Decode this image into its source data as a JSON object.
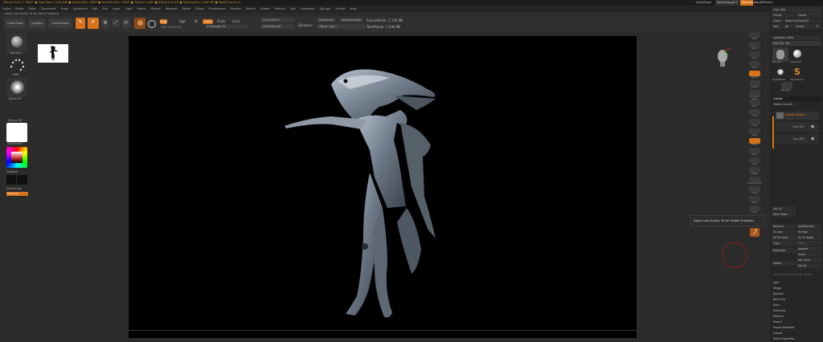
{
  "titlebar": {
    "text": "ZBrush 2021.7   Mat??   ● Free Mem 13.814GB ● Active Mem 4069 ● Scratch Disk 13252 ● Timer ▸ 0.001 ● ATime ▸ 0.013 ● PolyCount ▸ 3.581 MP ● MeshCount ▸ 2",
    "right_items": [
      "QuickSave",
      "See-through 0",
      "Menus",
      "DefaultZScript"
    ]
  },
  "menubar": {
    "items": [
      "Alpha",
      "Brush",
      "Color",
      "Document",
      "Draw",
      "Dynamics",
      "Edit",
      "File",
      "Layer",
      "Light",
      "Macro",
      "Marker",
      "Material",
      "Movie",
      "Picker",
      "Preferences",
      "Render",
      "Stencil",
      "Stroke",
      "Texture",
      "Tool",
      "Transform",
      "Zplugin",
      "Zscript",
      "Help"
    ]
  },
  "hint": "Apply Last Action To All Visible Subtools",
  "toolbar": {
    "home_page": "Home Page",
    "lightbox": "LightBox",
    "live_boolean": "Live Boolean",
    "edit": "Edit",
    "draw": "Draw",
    "move": "Move",
    "scale": "Scale",
    "rotate": "Rotate",
    "mrgb": "Mrgb",
    "rgb": "Rgb",
    "m": "M",
    "zadd": "Zadd",
    "zsub": "Zsub",
    "zcut": "Zcut",
    "rgb_intensity": "Rgb Intensity",
    "z_intensity": "Z Intensity 25",
    "focal_shift": "Focal Shift 0",
    "draw_size": "Draw Size 64",
    "dynamic": "Dynamic",
    "replay_last": "ReplayLast",
    "replay_last_rel": "ReplayLastRel",
    "adjust_last": "Adjust Last 1",
    "active_points": "ActivePoints: 1.730 Mil",
    "total_points": "TotalPoints: 1.530 Mil"
  },
  "left_tray": {
    "standard": "Standard",
    "dots": "Dots",
    "alpha_off": "Alpha Off",
    "texture_off": "Texture Off",
    "skin_shade": "SkinShade4",
    "gradient": "Gradient",
    "switch_color": "SwitchColor",
    "alternate": "Alternate"
  },
  "right_tray": {
    "items": [
      "BPR",
      "SPix 3",
      "Scroll",
      "Zoom",
      "Actual",
      "AAHalf",
      "Dynamic Persp",
      "Floor",
      "Local",
      "L.Sym",
      "Gxyz",
      "Frame",
      "Move",
      "Scale",
      "Rotate",
      "Line Fill PolyF",
      "Transp",
      "Ghost",
      "Solo",
      "Xpose"
    ]
  },
  "tooltip": "Apply Last Action To All Visible Subtools",
  "panel": {
    "copy_tool": "Copy Tool",
    "import": "Import",
    "export": "Export",
    "clone": "Clone",
    "make_polymesh": "Make PolyMesh3D",
    "goz": "GoZ",
    "all": "All",
    "visible": "Visible",
    "r": "R",
    "lightbox_tools": "Lightbox ▸ Tools",
    "current_tool": "Eye_001. 48",
    "tool_names": [
      "Eye_001",
      "Cylinder3D",
      "PolyMesh3D",
      "SimpleBrush",
      "Eye_001"
    ],
    "subtool_header": "Subtool",
    "visible_count": "Visible Count 8",
    "subtool_items": [
      "Subtool Hidden",
      "Eye_001",
      "Eye_002"
    ],
    "list_all": "List All",
    "new_folder": "New Folder",
    "rename": "Rename",
    "autoreorder": "AutoReorder",
    "all_low": "All Low",
    "all_high": "All High",
    "all_to_home": "All To Home",
    "all_to_target": "All To Target",
    "copy": "Copy",
    "paste": "Paste",
    "duplicate": "Duplicate",
    "append": "Append",
    "insert": "Insert",
    "del_other": "Del Other",
    "delete": "Delete",
    "del_all": "Del All",
    "apply_hint": "Apply Last Action To All Visible",
    "bottom_items": [
      "Split",
      "Merge",
      "Boolean",
      "Bevel Pro",
      "Align",
      "Distribute",
      "Remesh",
      "Project",
      "Project BasRelief",
      "Extract",
      "Polish Properties"
    ]
  },
  "colors": {
    "accent": "#d8731c",
    "canvas": "#000000",
    "background": "#2b2b2b"
  }
}
